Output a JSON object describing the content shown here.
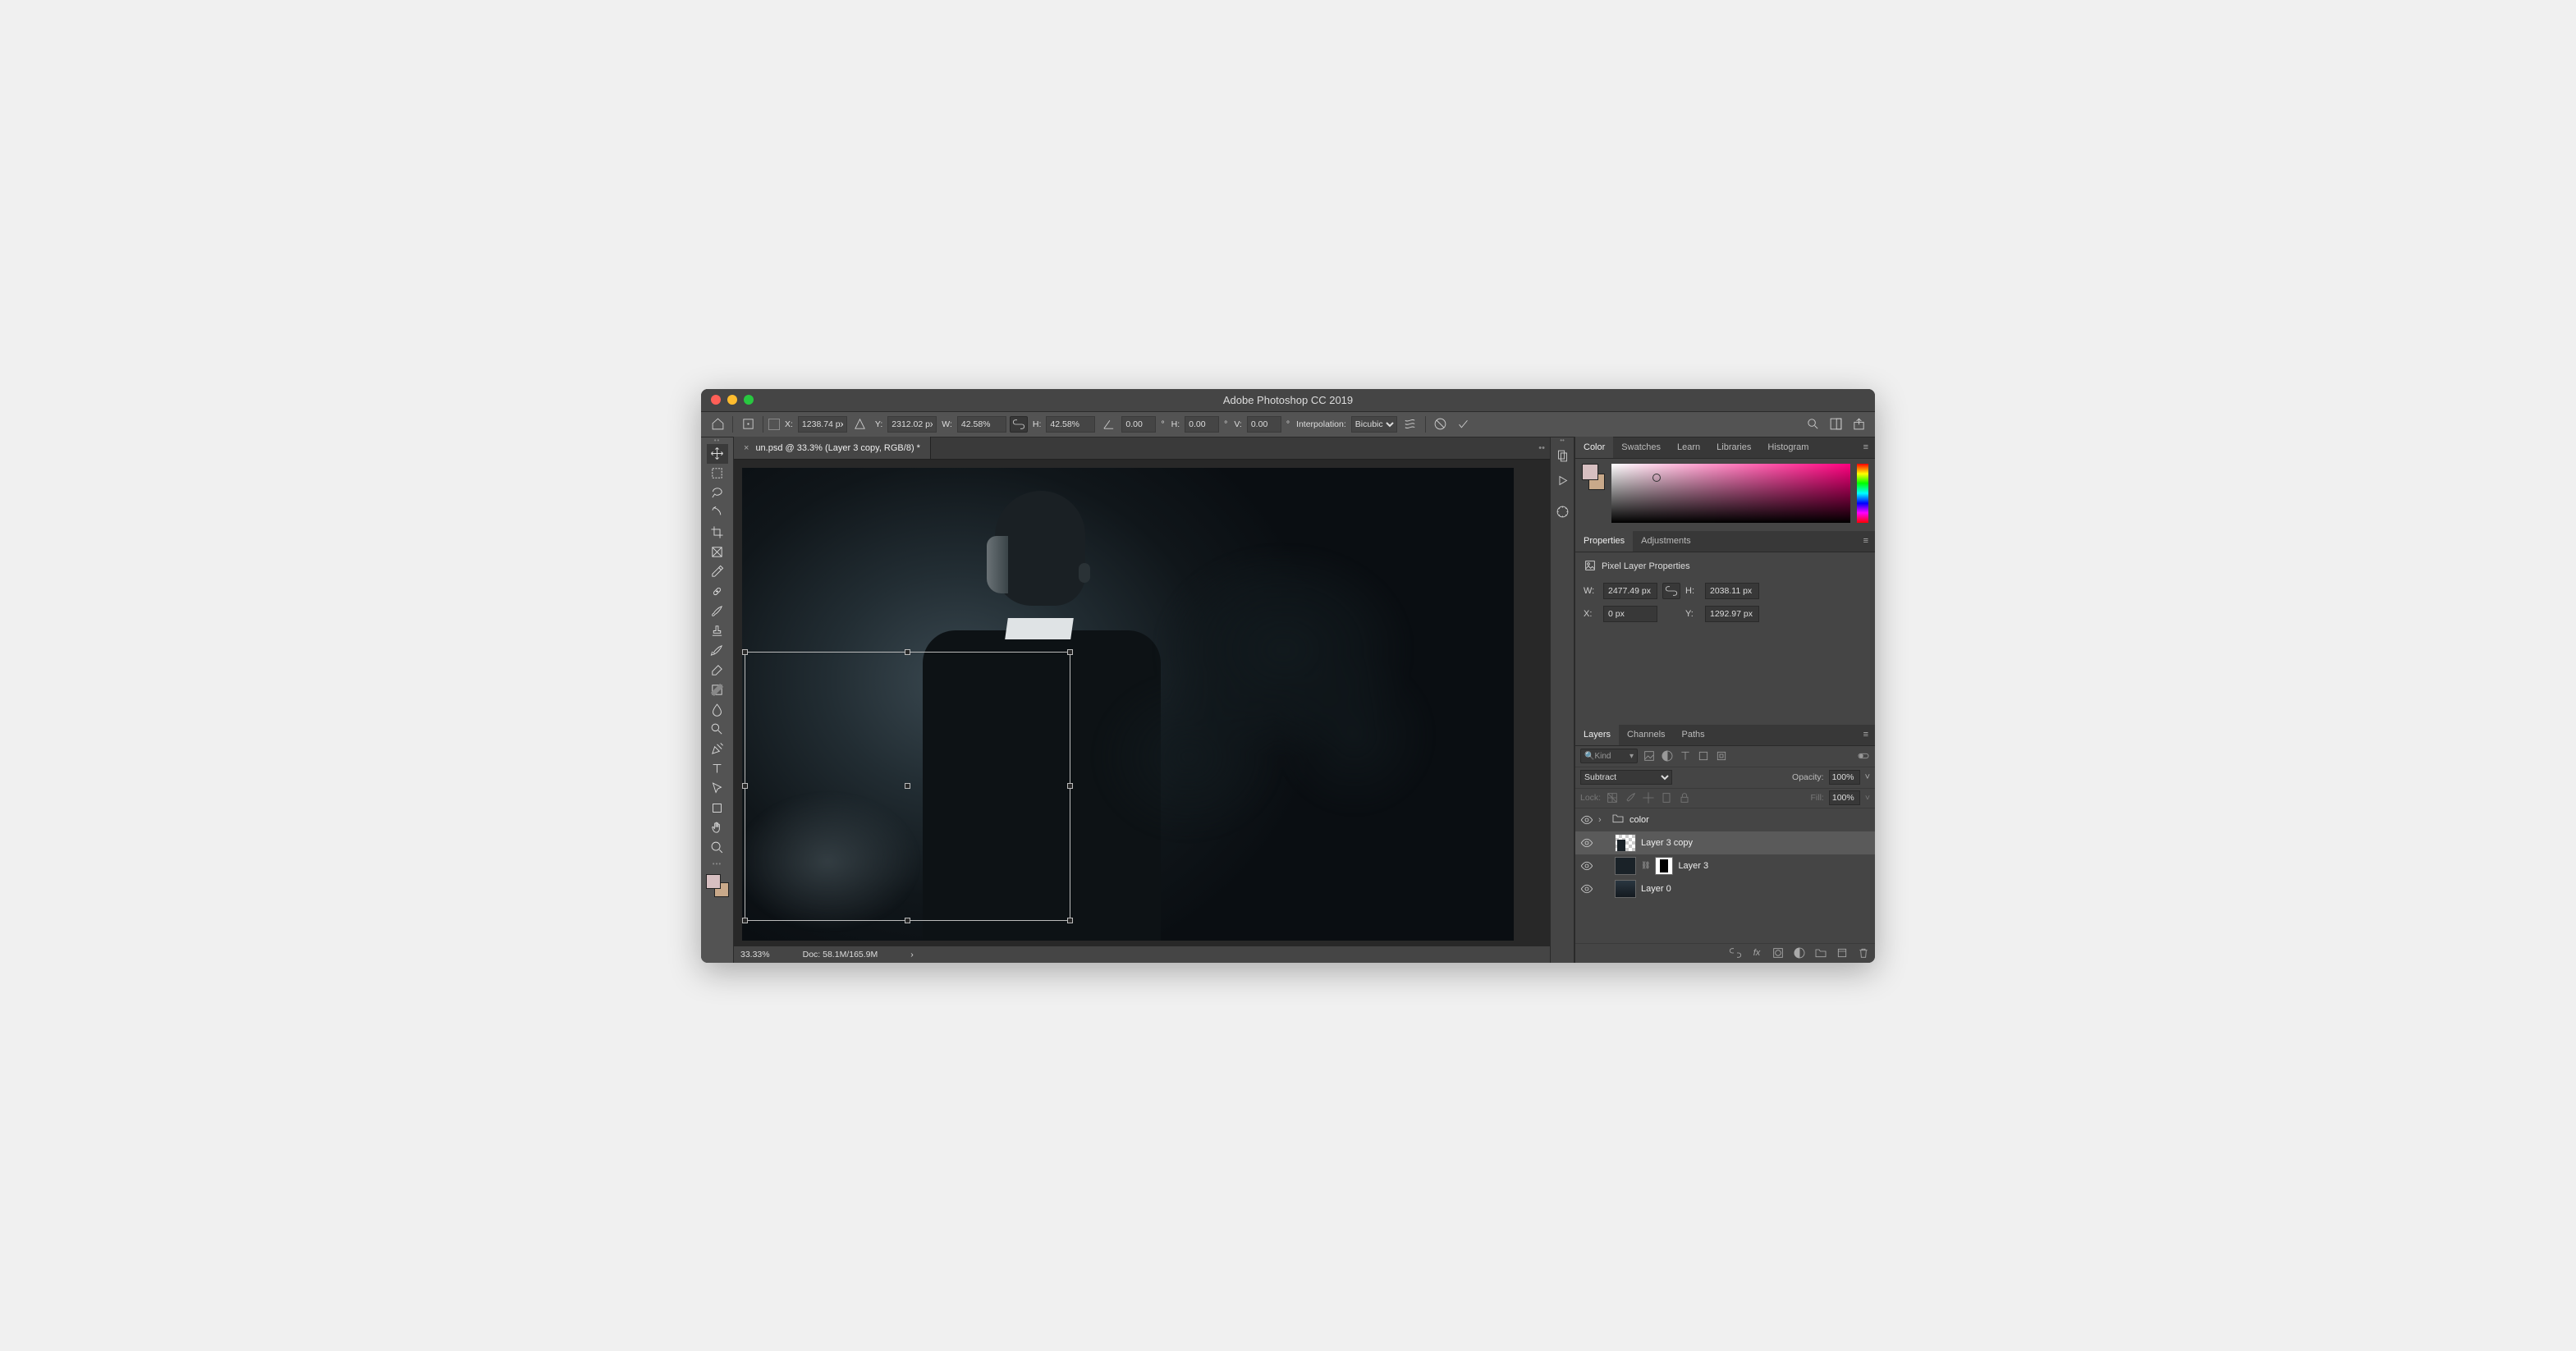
{
  "title": "Adobe Photoshop CC 2019",
  "options": {
    "x_label": "X:",
    "x": "1238.74 px",
    "y_label": "Y:",
    "y": "2312.02 px",
    "w_label": "W:",
    "w": "42.58%",
    "h_label": "H:",
    "h": "42.58%",
    "angle": "0.00",
    "skew_h_label": "H:",
    "skew_h": "0.00",
    "skew_v_label": "V:",
    "skew_v": "0.00",
    "interp_label": "Interpolation:",
    "interp": "Bicubic"
  },
  "document": {
    "tab": "un.psd @ 33.3% (Layer 3 copy, RGB/8) *",
    "zoom": "33.33%",
    "docinfo": "Doc: 58.1M/165.9M"
  },
  "panels": {
    "color": {
      "tabs": [
        "Color",
        "Swatches",
        "Learn",
        "Libraries",
        "Histogram"
      ],
      "fg": "#d7bfc1",
      "bg": "#c9a98a"
    },
    "props": {
      "tabs": [
        "Properties",
        "Adjustments"
      ],
      "title": "Pixel Layer Properties",
      "w_label": "W:",
      "w": "2477.49 px",
      "h_label": "H:",
      "h": "2038.11 px",
      "x_label": "X:",
      "x": "0 px",
      "y_label": "Y:",
      "y": "1292.97 px"
    },
    "layers": {
      "tabs": [
        "Layers",
        "Channels",
        "Paths"
      ],
      "kind": "Kind",
      "blend": "Subtract",
      "opacity_label": "Opacity:",
      "opacity": "100%",
      "lock_label": "Lock:",
      "fill_label": "Fill:",
      "fill": "100%",
      "items": [
        {
          "name": "color",
          "type": "group"
        },
        {
          "name": "Layer 3 copy",
          "type": "layer",
          "selected": true
        },
        {
          "name": "Layer 3",
          "type": "layer",
          "mask": true
        },
        {
          "name": "Layer 0",
          "type": "layer"
        }
      ]
    }
  }
}
